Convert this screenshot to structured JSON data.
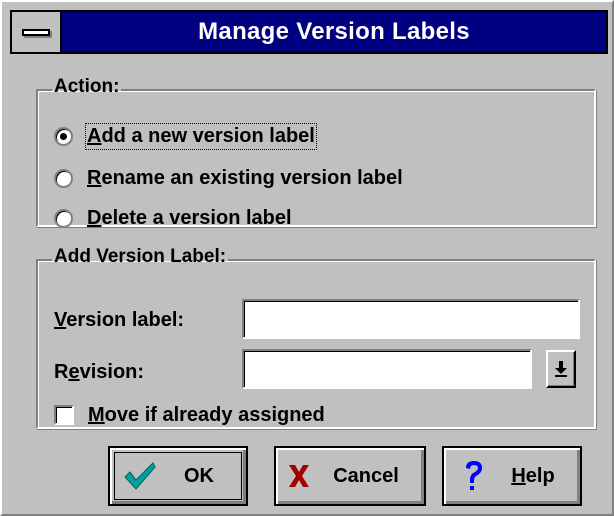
{
  "window": {
    "title": "Manage Version Labels"
  },
  "action_group": {
    "legend": "Action:",
    "options": [
      {
        "label": "Add a new version label",
        "mnemonic": "A",
        "rest": "dd a new version label",
        "checked": true
      },
      {
        "label": "Rename an existing version label",
        "mnemonic": "R",
        "rest": "ename an existing version label",
        "checked": false
      },
      {
        "label": "Delete a version label",
        "mnemonic": "D",
        "rest": "elete a version label",
        "checked": false
      }
    ]
  },
  "add_group": {
    "legend": "Add Version Label:",
    "version_label": {
      "mnemonic": "V",
      "rest": "ersion label:",
      "value": ""
    },
    "revision": {
      "pre": "R",
      "mnemonic": "e",
      "rest": "vision:",
      "value": ""
    },
    "move_checkbox": {
      "mnemonic": "M",
      "rest": "ove if already assigned",
      "checked": false
    }
  },
  "buttons": {
    "ok": {
      "label": "OK",
      "icon": "checkmark-icon",
      "color": "#008080"
    },
    "cancel": {
      "label": "Cancel",
      "icon": "x-icon",
      "color": "#800000"
    },
    "help": {
      "mnemonic": "H",
      "rest": "elp",
      "icon": "question-mark-icon",
      "color": "#0000ff"
    }
  },
  "colors": {
    "face": "#c0c0c0",
    "title_bar": "#000080"
  }
}
